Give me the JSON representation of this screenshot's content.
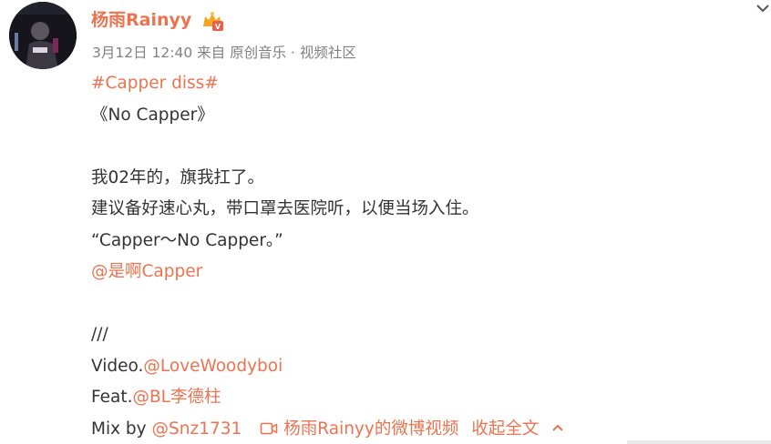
{
  "post": {
    "username": "杨雨Rainyy",
    "badge_icon": "vip-crown-icon",
    "avatar_icon": "user-avatar",
    "timestamp": "3月12日 12:40",
    "source_prefix": "来自",
    "source": "原创音乐 · 视频社区",
    "hashtag": "#Capper diss#",
    "title": "《No Capper》",
    "body": [
      "我02年的，旗我扛了。",
      "建议备好速心丸，带口罩去医院听，以便当场入住。",
      "“Capper～No Capper。”"
    ],
    "mention_main": "@是啊Capper",
    "separator": "///",
    "credits": [
      {
        "label": "Video.",
        "mention": "@LoveWoodyboi"
      },
      {
        "label": "Feat.",
        "mention": "@BL李德柱"
      },
      {
        "label": "Mix by ",
        "mention": "@Snz1731"
      }
    ],
    "video_link": "杨雨Rainyy的微博视频",
    "collapse_label": "收起全文"
  },
  "colors": {
    "accent": "#eb7350",
    "text": "#333333",
    "meta": "#808080"
  }
}
